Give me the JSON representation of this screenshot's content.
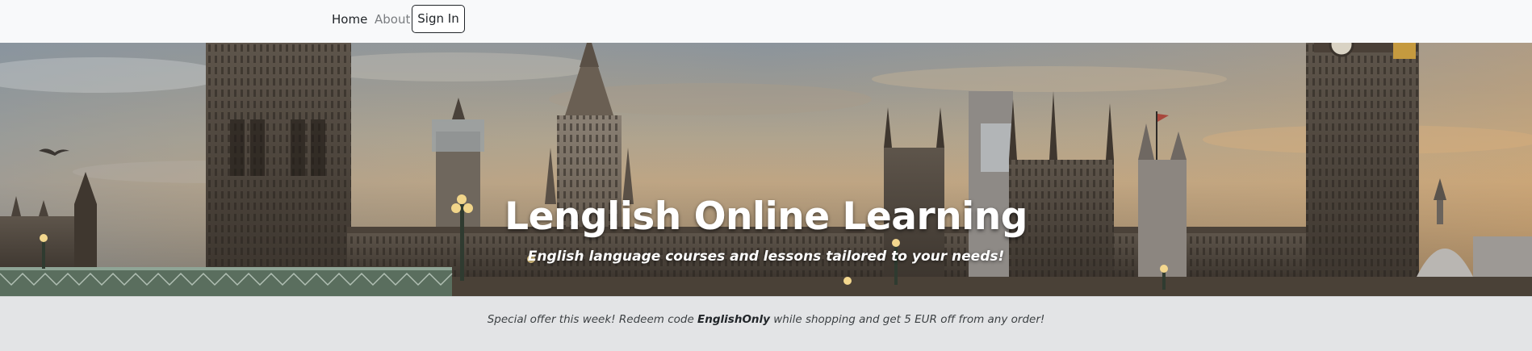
{
  "navbar": {
    "links": {
      "home": "Home",
      "about": "About"
    },
    "sign_in_label": "Sign In"
  },
  "hero": {
    "title": "Lenglish Online Learning",
    "subtitle": "English language courses and lessons tailored to your needs!"
  },
  "offer": {
    "text_before": "Special offer this week! Redeem code ",
    "code": "EnglishOnly",
    "text_after": " while shopping and get 5 EUR off from any order!"
  },
  "colors": {
    "navbar_bg": "#f8f9fa",
    "offer_bg": "#e3e4e6",
    "title_color": "#ffffff"
  },
  "icons": [
    "bird-icon",
    "flag-icon",
    "clock-face-icon",
    "lamp-post-icon"
  ]
}
